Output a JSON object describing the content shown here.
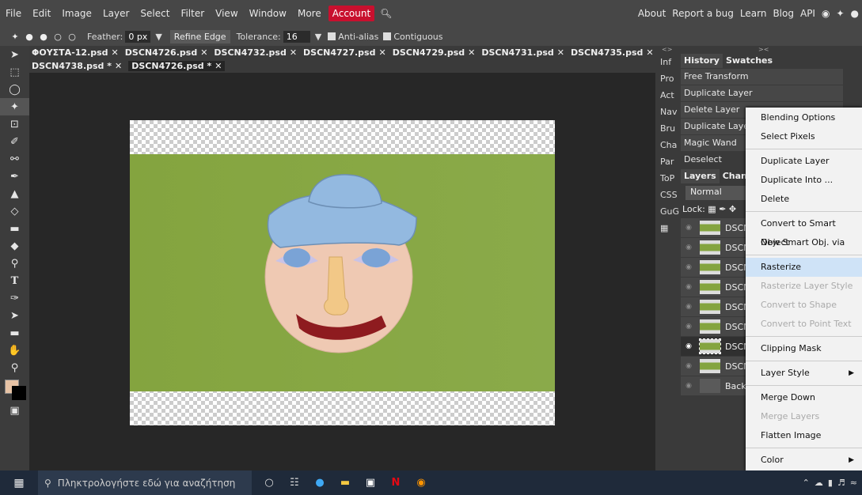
{
  "menubar": {
    "items": [
      "File",
      "Edit",
      "Image",
      "Layer",
      "Select",
      "Filter",
      "View",
      "Window",
      "More"
    ],
    "account": "Account",
    "right": [
      "About",
      "Report a bug",
      "Learn",
      "Blog",
      "API"
    ]
  },
  "options": {
    "feather_label": "Feather:",
    "feather_value": "0 px",
    "refine_edge": "Refine Edge",
    "tolerance_label": "Tolerance:",
    "tolerance_value": "16",
    "antialias": "Anti-alias",
    "contiguous": "Contiguous"
  },
  "tabs": {
    "row1": [
      "ΦΟΥΣΤΑ-12.psd",
      "DSCN4726.psd",
      "DSCN4732.psd",
      "DSCN4727.psd",
      "DSCN4729.psd",
      "DSCN4731.psd",
      "DSCN4735.psd"
    ],
    "row2": [
      "DSCN4738.psd *",
      "DSCN4726.psd *"
    ]
  },
  "side_strip": [
    "Inf",
    "Pro",
    "Act",
    "Nav",
    "Bru",
    "Cha",
    "Par",
    "ToP",
    "CSS",
    "GuG"
  ],
  "history": {
    "tabs": [
      "History",
      "Swatches"
    ],
    "items": [
      "Free Transform",
      "Duplicate Layer",
      "Delete Layer",
      "Duplicate Layer",
      "Magic Wand",
      "Deselect"
    ]
  },
  "layers": {
    "tabs": [
      "Layers",
      "Channe"
    ],
    "blend": "Normal",
    "lock_label": "Lock:",
    "items": [
      "DSCN",
      "DSCN",
      "DSCN",
      "DSCN",
      "DSCN",
      "DSCN",
      "DSCN",
      "DSCN",
      "Back"
    ]
  },
  "context_menu": {
    "items": [
      {
        "label": "Blending Options",
        "enabled": true
      },
      {
        "label": "Select Pixels",
        "enabled": true
      },
      {
        "label": "Duplicate Layer",
        "enabled": true
      },
      {
        "label": "Duplicate Into ...",
        "enabled": true
      },
      {
        "label": "Delete",
        "enabled": true
      },
      {
        "label": "Convert to Smart Object",
        "enabled": true
      },
      {
        "label": "New Smart Obj. via Copy",
        "enabled": true
      },
      {
        "label": "Rasterize",
        "enabled": true
      },
      {
        "label": "Rasterize Layer Style",
        "enabled": false
      },
      {
        "label": "Convert to Shape",
        "enabled": false
      },
      {
        "label": "Convert to Point Text",
        "enabled": false
      },
      {
        "label": "Clipping Mask",
        "enabled": true
      },
      {
        "label": "Layer Style",
        "enabled": true
      },
      {
        "label": "Merge Down",
        "enabled": true
      },
      {
        "label": "Merge Layers",
        "enabled": false
      },
      {
        "label": "Flatten Image",
        "enabled": true
      },
      {
        "label": "Color",
        "enabled": true
      }
    ]
  },
  "taskbar": {
    "search_placeholder": "Πληκτρολογήστε εδώ για αναζήτηση"
  },
  "colors": {
    "account_bg": "#c8102e",
    "highlight": "#cfe3f7",
    "canvas_green": "#86a643"
  }
}
